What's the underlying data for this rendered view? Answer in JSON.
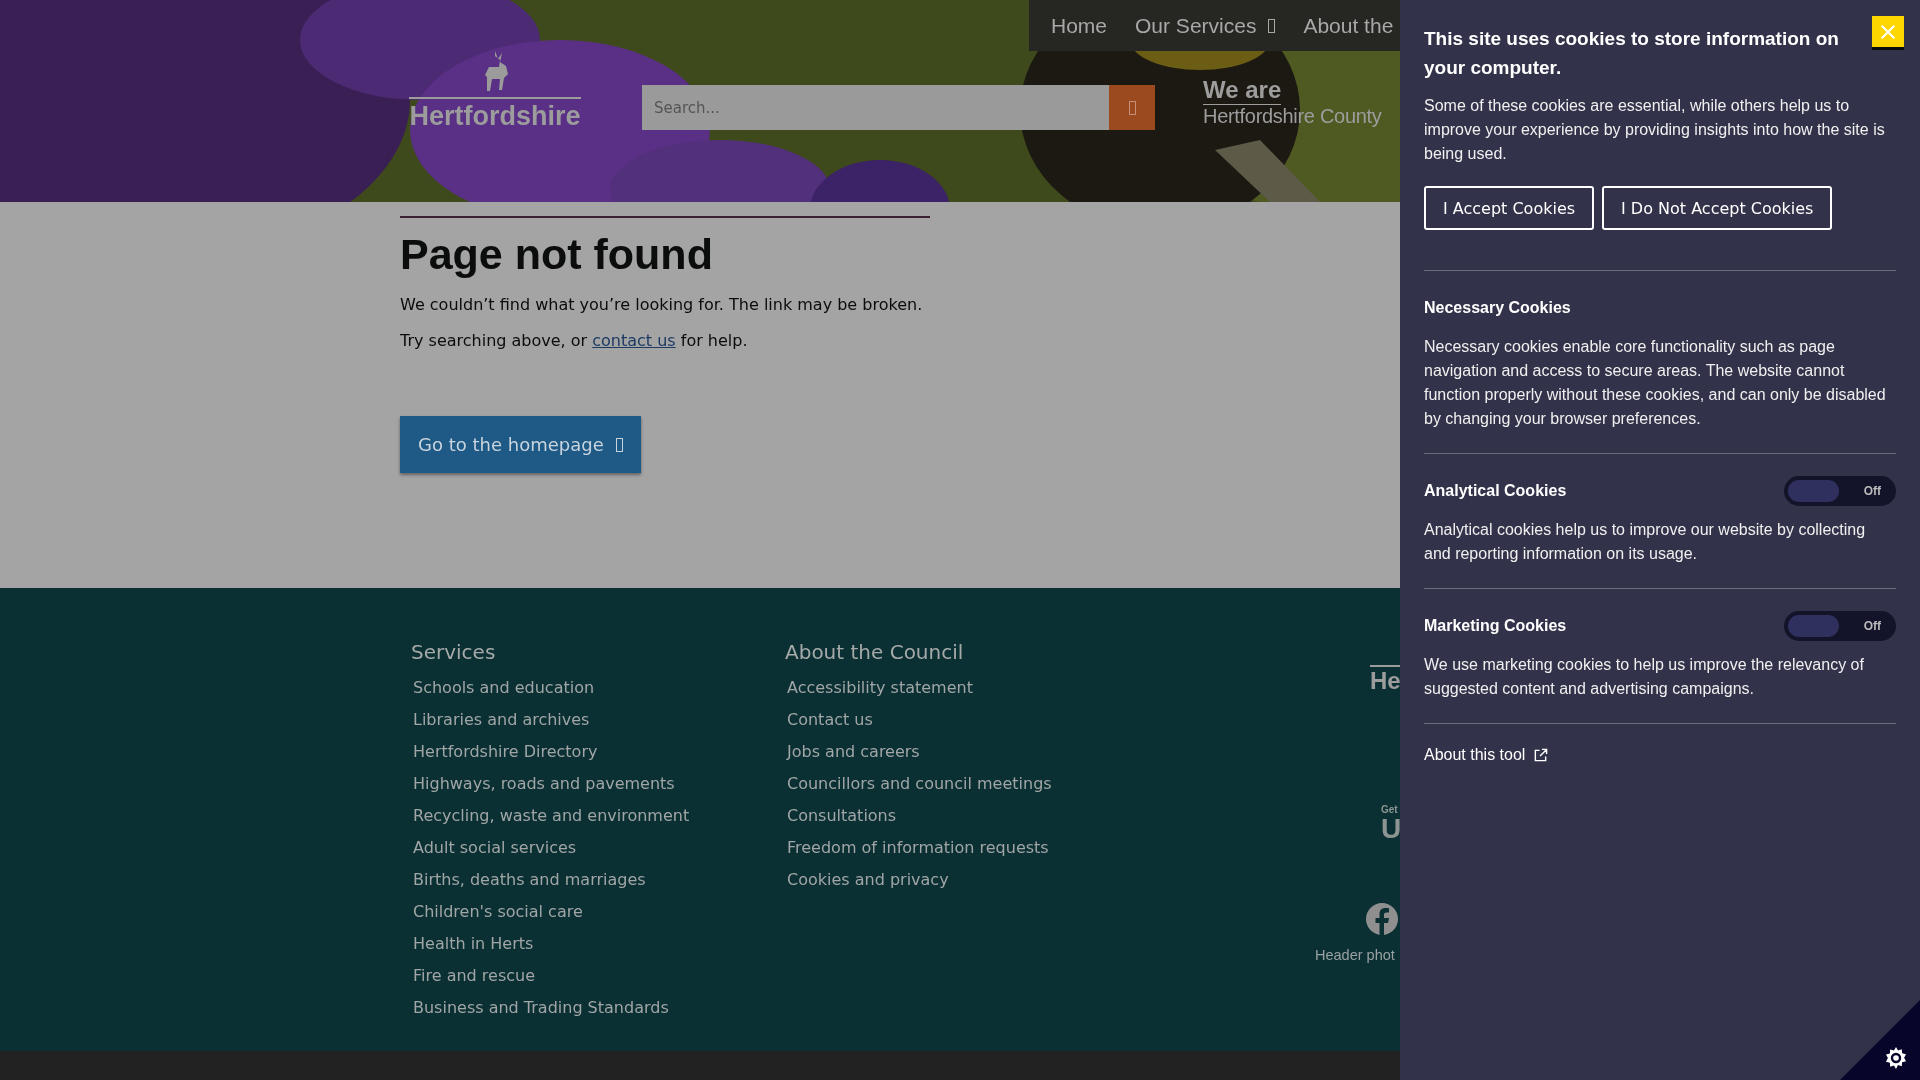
{
  "header": {
    "nav": [
      {
        "label": "Home",
        "has_menu": false
      },
      {
        "label": "Our Services",
        "has_menu": true
      },
      {
        "label": "About the",
        "has_menu": false
      }
    ],
    "logo_text": "Hertfordshire",
    "search": {
      "placeholder": "Search..."
    },
    "tagline": [
      "We are",
      "Hertfordshire County"
    ]
  },
  "main": {
    "title": "Page not found",
    "paragraph": "We couldn’t find what you’re looking for. The link may be broken.",
    "help": {
      "before": "Try searching above, or ",
      "link": "contact us",
      "after": " for help."
    },
    "button": "Go to the homepage"
  },
  "footer": {
    "columns": [
      {
        "heading": "Services",
        "links": [
          "Schools and education",
          "Libraries and archives",
          "Hertfordshire Directory",
          "Highways, roads and pavements",
          "Recycling, waste and environment",
          "Adult social services",
          "Births, deaths and marriages",
          "Children's social care",
          "Health in Herts",
          "Fire and rescue",
          "Business and Trading Standards"
        ]
      },
      {
        "heading": "About the Council",
        "links": [
          "Accessibility statement",
          "Contact us",
          "Jobs and careers",
          "Councillors and council meetings",
          "Consultations",
          "Freedom of information requests",
          "Cookies and privacy"
        ]
      }
    ],
    "logo_text": "He",
    "app_small": "Get",
    "app_big": "U",
    "credit": "Header phot"
  },
  "cookie_panel": {
    "title": "This site uses cookies to store information on your computer.",
    "intro": "Some of these cookies are essential, while others help us to improve your experience by providing insights into how the site is being used.",
    "buttons": [
      "I Accept Cookies",
      "I Do Not Accept Cookies"
    ],
    "sections": [
      {
        "kind": "info",
        "title": "Necessary Cookies",
        "text": "Necessary cookies enable core functionality such as page navigation and access to secure areas. The website cannot function properly without these cookies, and can only be disabled by changing your browser preferences."
      },
      {
        "kind": "toggle",
        "title": "Analytical Cookies",
        "on": false,
        "state_label": "Off",
        "text": "Analytical cookies help us to improve our website by collecting and reporting information on its usage."
      },
      {
        "kind": "toggle",
        "title": "Marketing Cookies",
        "on": false,
        "state_label": "Off",
        "text": "We use marketing cookies to help us improve the relevancy of suggested content and advertising campaigns."
      }
    ],
    "about_link": "About this tool"
  }
}
